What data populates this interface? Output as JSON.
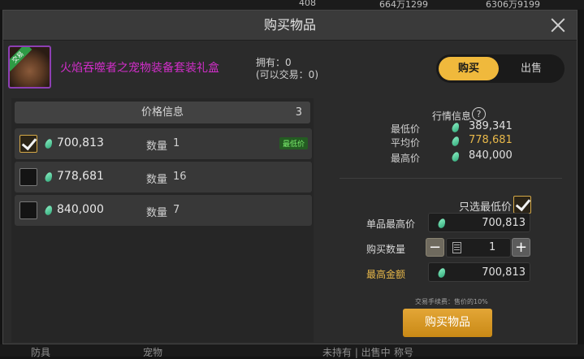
{
  "background": {
    "currency1": "408",
    "currency2": "664万1299",
    "currency3": "6306万9199",
    "bottom_tab1": "防具",
    "bottom_tab2": "宠物",
    "bottom_text": "未持有 | 出售中",
    "bottom_tab3": "称号"
  },
  "dialog": {
    "title": "购买物品",
    "item": {
      "name": "火焰吞噬者之宠物装备套装礼盒",
      "badge": "交易",
      "icon": "treasure-box-icon",
      "owned": "拥有：0",
      "tradable": "(可以交易：0)"
    },
    "tabs": {
      "buy": "购买",
      "sell": "出售"
    },
    "price_info": {
      "title": "价格信息",
      "count": "3",
      "quantity_label": "数量",
      "rows": [
        {
          "price": "700,813",
          "qty": "1",
          "badge": "最低价",
          "checked": true
        },
        {
          "price": "778,681",
          "qty": "16",
          "badge": "",
          "checked": false
        },
        {
          "price": "840,000",
          "qty": "7",
          "badge": "",
          "checked": false
        }
      ]
    },
    "market": {
      "title": "行情信息",
      "help_icon": "?",
      "min_label": "最低价",
      "min_value": "389,341",
      "avg_label": "平均价",
      "avg_value": "778,681",
      "max_label": "最高价",
      "max_value": "840,000"
    },
    "form": {
      "lowest_only_label": "只选最低价",
      "lowest_only_checked": true,
      "unit_max_label": "单品最高价",
      "unit_max_value": "700,813",
      "qty_label": "购买数量",
      "qty_value": "1",
      "max_total_label": "最高金额",
      "max_total_value": "700,813",
      "fee_text": "交易手续费：售价的10%"
    },
    "buy_button": "购买物品"
  },
  "colors": {
    "accent": "#f0b93c",
    "item_name": "#d12ec9",
    "best_badge": "#7cef6e",
    "gold_text": "#e8b84a"
  }
}
